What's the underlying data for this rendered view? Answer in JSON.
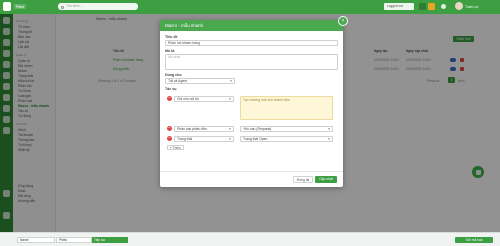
{
  "topbar": {
    "brand": "Fiber",
    "search_placeholder": "Tìm kiếm...",
    "status": "Logged out",
    "user": "Tuấn Lợi"
  },
  "sidebar": {
    "items": [
      {
        "label": "Hệ thống"
      },
      {
        "label": "Tổ chức"
      },
      {
        "label": "Thống kê"
      },
      {
        "label": "Bảo cáo"
      },
      {
        "label": "Lịch sử"
      },
      {
        "label": "Cài đặt"
      },
      {
        "label": "Quản lý"
      },
      {
        "label": "Quản trị"
      },
      {
        "label": "Đội nhóm"
      },
      {
        "label": "Nhóm"
      },
      {
        "label": "Trạng thái"
      },
      {
        "label": "Mẫu trả lời"
      },
      {
        "label": "Phản hồi"
      },
      {
        "label": "Từ khóa"
      },
      {
        "label": "Luật gán"
      },
      {
        "label": "Phân loại"
      },
      {
        "label": "Macro - mẫu nhanh"
      },
      {
        "label": "Tác vụ"
      },
      {
        "label": "Tự động"
      },
      {
        "label": "Cá nhân"
      },
      {
        "label": "Kênh"
      },
      {
        "label": "Tài khoản"
      },
      {
        "label": "Thông báo"
      },
      {
        "label": "Tích hợp"
      },
      {
        "label": "Nhật ký"
      },
      {
        "label": "Ứng dụng"
      },
      {
        "label": "Khác"
      },
      {
        "label": "Mở rộng"
      },
      {
        "label": "Hướng dẫn"
      }
    ]
  },
  "background": {
    "page_title": "Macro - mẫu nhanh",
    "column_headers": [
      "Tiêu đề",
      "Ngày tạo",
      "Ngày cập nhật"
    ],
    "rows": [
      {
        "title": "Phản hồi khách hàng",
        "created": "07/08/2022 18:01",
        "updated": "07/08/2022 18:01"
      },
      {
        "title": "Đóng phiếu",
        "created": "20/08/2022 18:01",
        "updated": "20/08/2022 18:01"
      }
    ],
    "footer_text": "Showing 1 to 2 of 2 entries",
    "add_label": "Thêm mới",
    "pager_prev": "Previous",
    "pager_page": "1",
    "pager_next": "Next"
  },
  "modal": {
    "title": "Macro - mẫu nhanh",
    "title_label": "Tiêu đề",
    "title_value": "Phản hồi khách hàng",
    "desc_label": "Mô tả",
    "desc_placeholder": "Mô phát",
    "apply_label": "Dùng cho",
    "apply_value": "Tất cả Agent",
    "actions_label": "Tác vụ",
    "actions": [
      {
        "field": "Ghi chú nội bộ",
        "value": "Tạo trường mới cho thành viên"
      },
      {
        "field": "Phân loại phiếu đến",
        "value": "Yêu cầu (Request)"
      },
      {
        "field": "Trạng thái",
        "value": "Trạng thái Open"
      }
    ],
    "add_action_label": "Thêm",
    "cancel_label": "Đóng lại",
    "save_label": "Cập nhật"
  },
  "bottombar": {
    "col1": "Name",
    "col2": "Phiếu",
    "dropdown": "Tiếp tục",
    "button": "Gửi mã hoá"
  },
  "colors": {
    "brand": "#3d9e42",
    "danger": "#e04848",
    "highlight": "#fdf6d7"
  }
}
